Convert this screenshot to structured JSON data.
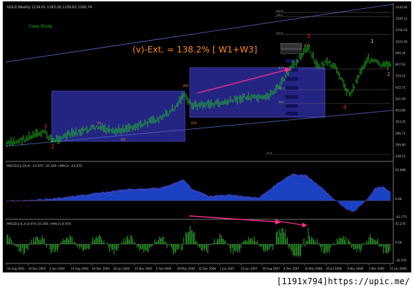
{
  "window": {
    "title": "GOLD,Weekly 1134.01 1163.26 1109.63 1160.74"
  },
  "annotations": {
    "case_study": "Case Study",
    "headline": "(v)-Ext. = 138.2% [ W1+W3]",
    "wave_labels": {
      "w1_top": "1",
      "w2_low": "2",
      "w3_top": "3",
      "w4_low": "4",
      "sub_i": "(i)",
      "sub_ii": "(ii)",
      "sub_iii": "(iii)",
      "sub_iv": "(iv)",
      "sub_v": "(v)",
      "post_1": "1",
      "post_2": "2"
    }
  },
  "price_axis": {
    "ticks": [
      "1432.00",
      "1293.12",
      "1154.24",
      "1023.04",
      "949.26",
      "827.63",
      "724.15",
      "632.71",
      "521.60",
      "453.66",
      "353.25",
      "286.71",
      "294.60",
      "238.51"
    ]
  },
  "macd_panel_1": {
    "title": "MACD(12,26,9) -23.975 -35.169 +MA(1) -23.975",
    "ticks": [
      "63.698",
      "0.00",
      "-41.773"
    ]
  },
  "macd_panel_2": {
    "title": "MACD(2,6,3) 8.970 10.206 +MA(1) 8.970",
    "ticks": [
      "41.274",
      "0.00",
      "-34.970"
    ]
  },
  "time_axis": {
    "labels": [
      "16 Aug 2002",
      "14 Dec 2003",
      "4 Apr 2004",
      "14 Aug 2004",
      "19 Dec 2004",
      "26 Jun 2005",
      "22 Nov 2005",
      "5 Feb 2006",
      "28 May 2006",
      "25 Dec 2006",
      "7 Jan 2007",
      "25 Jun 2007",
      "19 Aug 2007",
      "9 Dec 2007",
      "30 Mar 2008",
      "20 Jul 2008",
      "9 Nov 2008",
      "1 Mar 2009",
      "21 Jun 2009"
    ]
  },
  "fib_labels": [
    "161.8",
    "138.2",
    "100.0",
    "61.8",
    "50.0",
    "38.2",
    "23.6"
  ],
  "watermark": "[1191x794]https://upic.me/",
  "colors": {
    "background": "#000000",
    "candle": "#22cc22",
    "box": "#2a2a9a",
    "trendline": "#5a6fd0",
    "headline": "#ff8c1a",
    "case_study": "#18c018",
    "wave": "#ff2020",
    "arrow": "#ff2d8c",
    "macd_fill": "#1e48d8",
    "macd2": "#38c838"
  }
}
